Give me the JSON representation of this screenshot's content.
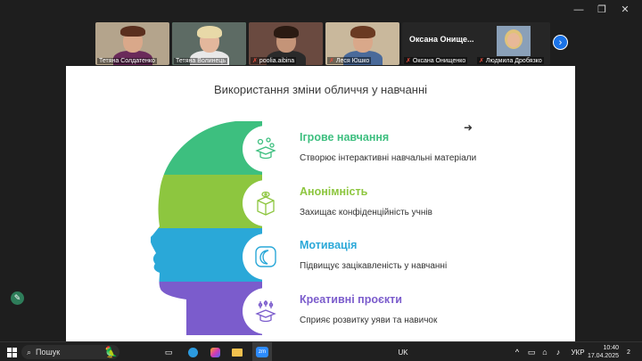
{
  "window": {
    "minimize": "—",
    "restore": "❐",
    "close": "✕"
  },
  "participants": [
    {
      "name": "Тетяна Солдатенко",
      "muted": false
    },
    {
      "name": "Тетяна Волинець",
      "muted": false
    },
    {
      "name": "poolia.aibina",
      "muted": true
    },
    {
      "name": "Леся Юшко",
      "muted": true
    },
    {
      "name": "Оксана Онищенко",
      "muted": true,
      "display": "Оксана  Онище..."
    },
    {
      "name": "Людмила Дробязко",
      "muted": true
    }
  ],
  "slide": {
    "title": "Використання зміни обличчя у навчанні",
    "rows": [
      {
        "title": "Ігрове навчання",
        "desc": "Створює інтерактивні навчальні матеріали",
        "color": "#3dbf7f"
      },
      {
        "title": "Анонімність",
        "desc": "Захищає конфіденційність учнів",
        "color": "#8dc63f"
      },
      {
        "title": "Мотивація",
        "desc": "Підвищує зацікавленість у навчанні",
        "color": "#2aa8d8"
      },
      {
        "title": "Креативні проєкти",
        "desc": "Сприяє розвитку уяви та навичок",
        "color": "#7b5ccc"
      }
    ]
  },
  "taskbar": {
    "search_placeholder": "Пошук",
    "tray_uk": "UK",
    "lang": "УКР",
    "time": "10:40",
    "date": "17.04.2025",
    "notifications": "2"
  }
}
